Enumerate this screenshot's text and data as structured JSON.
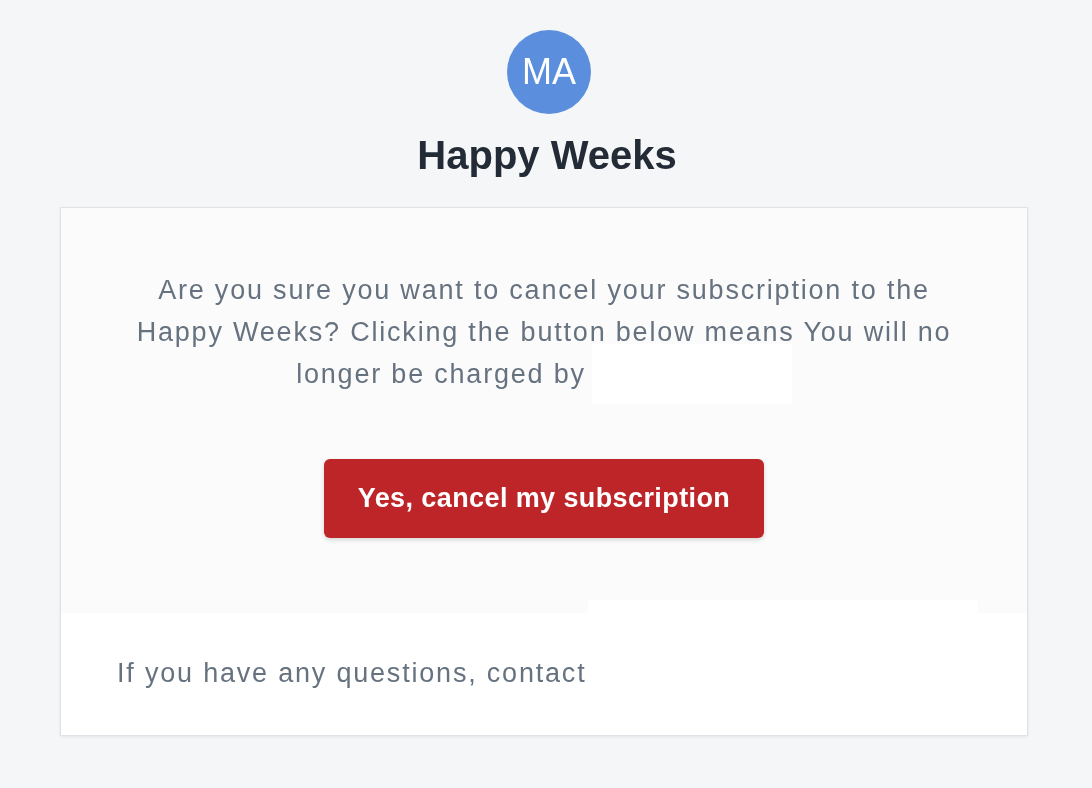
{
  "avatar": {
    "initials": "MA"
  },
  "title": "Happy Weeks",
  "message": {
    "text": "Are you sure you want to cancel your subscription to the Happy Weeks? Clicking the button below means You will no longer be charged by",
    "redacted": true
  },
  "cancel_button": {
    "label": "Yes, cancel my subscription"
  },
  "footer": {
    "text": "If you have any questions, contact",
    "redacted": true
  }
}
